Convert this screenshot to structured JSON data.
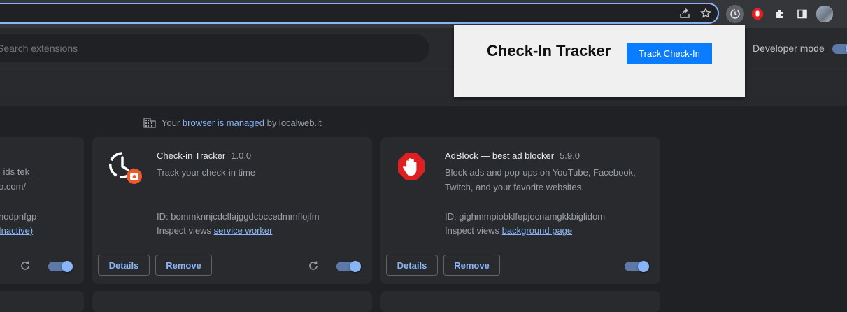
{
  "search": {
    "placeholder": "Search extensions"
  },
  "header": {
    "developer_mode_label": "Developer mode"
  },
  "managed": {
    "prefix": "Your",
    "link": "browser is managed",
    "suffix": "by localweb.it"
  },
  "cards": [
    {
      "partial": true,
      "desc_line1": "i ids tek",
      "desc_line2": "o.com/",
      "id_fragment": "hodpnfgp",
      "inspect_fragment": "Inactive)"
    },
    {
      "title": "Check-in Tracker",
      "version": "1.0.0",
      "description": "Track your check-in time",
      "id_label": "ID: bommknnjcdcflajggdcbccedmmflojfm",
      "inspect_prefix": "Inspect views",
      "inspect_link": "service worker",
      "details_label": "Details",
      "remove_label": "Remove",
      "enabled": true
    },
    {
      "title": "AdBlock — best ad blocker",
      "version": "5.9.0",
      "description_line1": "Block ads and pop-ups on YouTube, Facebook,",
      "description_line2": "Twitch, and your favorite websites.",
      "id_label": "ID: gighmmpiobklfepjocnamgkkbiglidom",
      "inspect_prefix": "Inspect views",
      "inspect_link": "background page",
      "details_label": "Details",
      "remove_label": "Remove",
      "enabled": true
    }
  ],
  "popup": {
    "title": "Check-In Tracker",
    "button_label": "Track Check-In"
  },
  "colors": {
    "accent": "#8ab4f8",
    "popup_button": "#0a7cff",
    "adblock_red": "#e02020",
    "badge_orange": "#ea5a2c"
  }
}
